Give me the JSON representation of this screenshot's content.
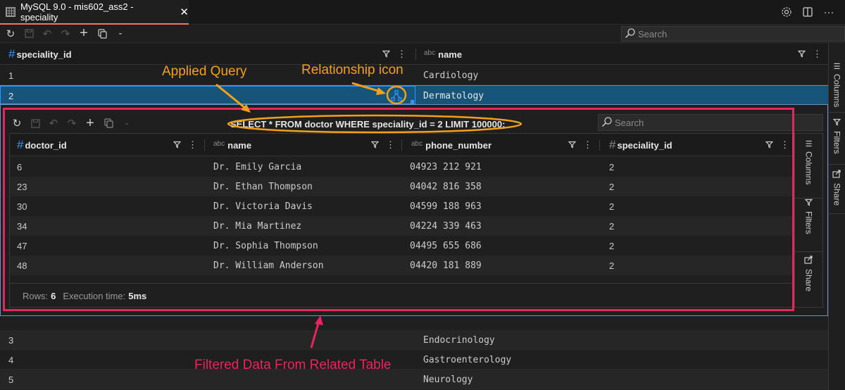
{
  "tab": {
    "title": "MySQL 9.0 - mis602_ass2 - speciality",
    "icon": "table-grid-icon",
    "actions": [
      "gear-icon",
      "split-editor-icon",
      "more-icon"
    ]
  },
  "toolbar": {
    "buttons": [
      "refresh-icon",
      "save-icon",
      "undo-icon",
      "redo-icon",
      "add-row-icon",
      "copy-icon",
      "remove-row-icon"
    ],
    "search_placeholder": "Search"
  },
  "outer_grid": {
    "columns": [
      {
        "name": "speciality_id",
        "type": "number"
      },
      {
        "name": "name",
        "type": "text",
        "type_label": "abc"
      }
    ],
    "rows": [
      {
        "id": "1",
        "name": "Cardiology"
      },
      {
        "id": "2",
        "name": "Dermatology",
        "selected": true
      },
      {
        "id": "3",
        "name": "Endocrinology"
      },
      {
        "id": "4",
        "name": "Gastroenterology"
      },
      {
        "id": "5",
        "name": "Neurology"
      }
    ],
    "side_panel": [
      "Columns",
      "Filters",
      "Share"
    ]
  },
  "nested": {
    "query": "SELECT * FROM doctor WHERE speciality_id = 2 LIMIT 100000;",
    "search_placeholder": "Search",
    "columns": [
      {
        "name": "doctor_id",
        "type": "number"
      },
      {
        "name": "name",
        "type": "text",
        "type_label": "abc"
      },
      {
        "name": "phone_number",
        "type": "text",
        "type_label": "abc"
      },
      {
        "name": "speciality_id",
        "type": "number"
      }
    ],
    "rows": [
      [
        "6",
        "Dr. Emily Garcia",
        "04923 212 921",
        "2"
      ],
      [
        "23",
        "Dr. Ethan Thompson",
        "04042 816 358",
        "2"
      ],
      [
        "30",
        "Dr. Victoria Davis",
        "04599 188 963",
        "2"
      ],
      [
        "34",
        "Dr. Mia Martinez",
        "04224 339 463",
        "2"
      ],
      [
        "47",
        "Dr. Sophia Thompson",
        "04495 655 686",
        "2"
      ],
      [
        "48",
        "Dr. William Anderson",
        "04420 181 889",
        "2"
      ]
    ],
    "status": {
      "rows_label": "Rows:",
      "rows_value": "6",
      "time_label": "Execution time:",
      "time_value": "5ms"
    },
    "side_panel": [
      "Columns",
      "Filters",
      "Share"
    ]
  },
  "annotations": {
    "applied_query": "Applied Query",
    "relationship_icon": "Relationship icon",
    "filtered_data": "Filtered Data From Related Table",
    "colors": {
      "orange": "#f5a01a",
      "pink": "#e8265e"
    }
  },
  "colors": {
    "accent": "#3794ff",
    "selection": "#175479",
    "tab_underline": "#f0775a"
  }
}
